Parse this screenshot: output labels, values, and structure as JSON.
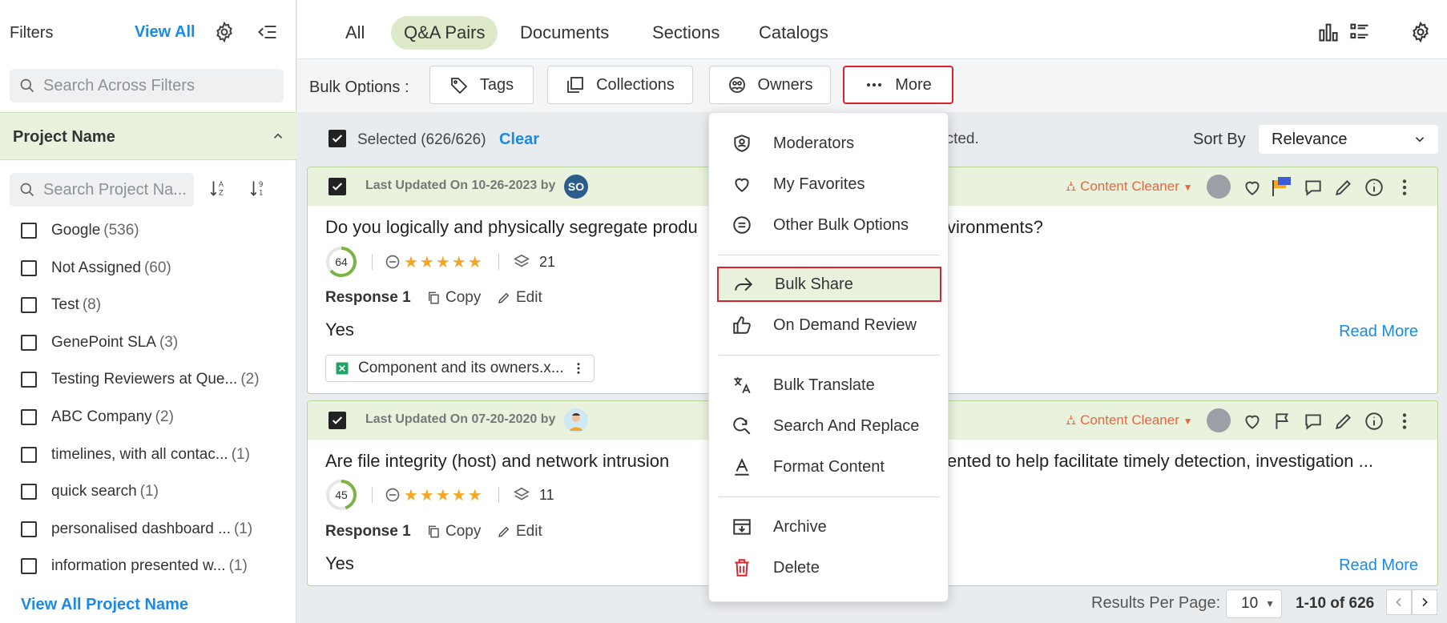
{
  "sidebar": {
    "title": "Filters",
    "view_all": "View All",
    "search_placeholder": "Search Across Filters",
    "project_section": {
      "label": "Project Name",
      "search_placeholder": "Search Project Na...",
      "items": [
        {
          "label": "Google",
          "count": "(536)"
        },
        {
          "label": "Not Assigned",
          "count": "(60)"
        },
        {
          "label": "Test",
          "count": "(8)"
        },
        {
          "label": "GenePoint SLA",
          "count": "(3)"
        },
        {
          "label": "Testing Reviewers at Que...",
          "count": "(2)"
        },
        {
          "label": "ABC Company",
          "count": "(2)"
        },
        {
          "label": "timelines, with all contac...",
          "count": "(1)"
        },
        {
          "label": "quick search",
          "count": "(1)"
        },
        {
          "label": "personalised dashboard ...",
          "count": "(1)"
        },
        {
          "label": "information presented w...",
          "count": "(1)"
        }
      ],
      "view_all_link": "View All Project Name"
    }
  },
  "tabs": [
    {
      "label": "All",
      "active": false
    },
    {
      "label": "Q&A Pairs",
      "active": true
    },
    {
      "label": "Documents",
      "active": false
    },
    {
      "label": "Sections",
      "active": false
    },
    {
      "label": "Catalogs",
      "active": false
    }
  ],
  "bulk": {
    "label": "Bulk Options :",
    "tags": "Tags",
    "collections": "Collections",
    "owners": "Owners",
    "more": "More"
  },
  "selection": {
    "text": "Selected (626/626)",
    "clear": "Clear",
    "partial_text": "ected.",
    "sort_label": "Sort By",
    "sort_value": "Relevance"
  },
  "cards": [
    {
      "updated": "Last Updated On 10-26-2023 by",
      "avatar_initials": "SO",
      "content_cleaner": "Content Cleaner",
      "question_left": "Do you logically and physically segregate produ",
      "question_right": "vironments?",
      "score": "64",
      "usage_count": "21",
      "response_label": "Response 1",
      "copy": "Copy",
      "edit": "Edit",
      "answer": "Yes",
      "read_more": "Read More",
      "attachment": "Component and its owners.x..."
    },
    {
      "updated": "Last Updated On 07-20-2020 by",
      "content_cleaner": "Content Cleaner",
      "question_left": "Are file integrity (host) and network intrusion",
      "question_right": "ented to help facilitate timely detection, investigation ...",
      "score": "45",
      "usage_count": "11",
      "response_label": "Response 1",
      "copy": "Copy",
      "edit": "Edit",
      "answer": "Yes",
      "read_more": "Read More"
    }
  ],
  "menu": {
    "items": [
      {
        "label": "Moderators",
        "icon": "shield-user-icon"
      },
      {
        "label": "My Favorites",
        "icon": "heart-icon"
      },
      {
        "label": "Other Bulk Options",
        "icon": "equals-circle-icon"
      },
      {
        "label": "Bulk Share",
        "icon": "share-arrow-icon"
      },
      {
        "label": "On Demand Review",
        "icon": "thumbs-up-icon"
      },
      {
        "label": "Bulk Translate",
        "icon": "translate-icon"
      },
      {
        "label": "Search And Replace",
        "icon": "search-replace-icon"
      },
      {
        "label": "Format Content",
        "icon": "format-text-icon"
      },
      {
        "label": "Archive",
        "icon": "archive-icon"
      },
      {
        "label": "Delete",
        "icon": "trash-icon"
      }
    ]
  },
  "pagination": {
    "results_label": "Results Per Page:",
    "per_page": "10",
    "range": "1-10 of 626"
  },
  "colors": {
    "accent_blue": "#1a8ae5",
    "active_tab_bg": "#dde9c8",
    "highlight_red": "#d9232e",
    "content_cleaner": "#e8663d",
    "star": "#f5a623"
  }
}
